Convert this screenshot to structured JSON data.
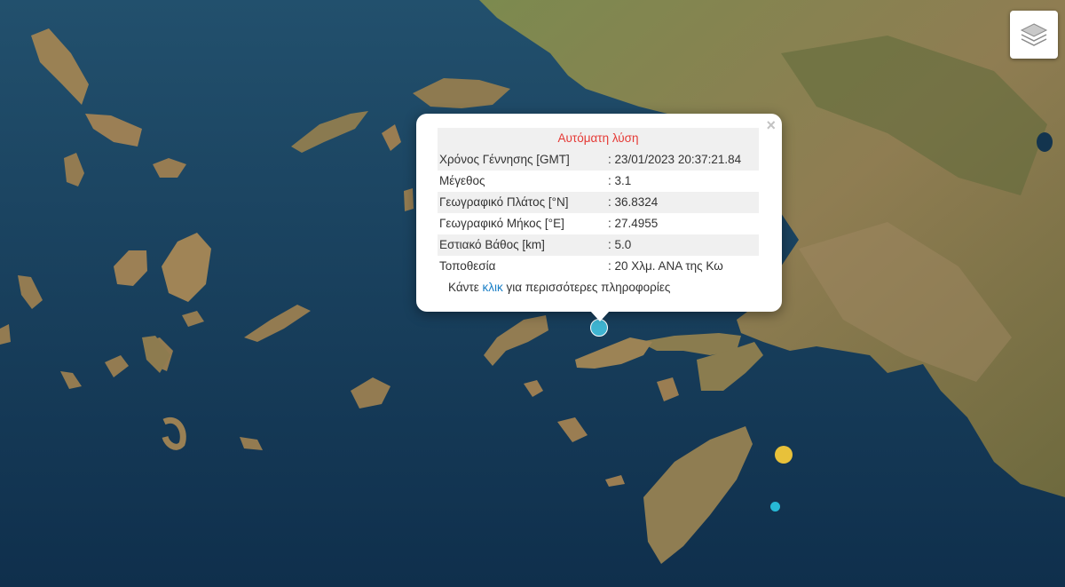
{
  "map": {
    "layers_icon": "layers-icon"
  },
  "popup": {
    "title": "Αυτόματη λύση",
    "title_color": "#e53935",
    "close_symbol": "×",
    "rows": [
      {
        "label": "Χρόνος Γέννησης [GMT]",
        "value": ": 23/01/2023 20:37:21.84"
      },
      {
        "label": "Μέγεθος",
        "value": ": 3.1"
      },
      {
        "label": "Γεωγραφικό Πλάτος [°N]",
        "value": ": 36.8324"
      },
      {
        "label": "Γεωγραφικό Μήκος [°E]",
        "value": ": 27.4955"
      },
      {
        "label": "Εστιακό Βάθος [km]",
        "value": ": 5.0"
      },
      {
        "label": "Τοποθεσία",
        "value": ": 20 Χλμ. ΑΝΑ της Κω"
      }
    ],
    "more_prefix": "Κάντε",
    "more_link": "κλικ",
    "more_suffix": "για περισσότερες πληροφορίες"
  },
  "markers": [
    {
      "name": "selected-quake",
      "color": "#3fb4d1"
    },
    {
      "name": "quake-yellow",
      "color": "#e8c13a"
    },
    {
      "name": "quake-small-cyan",
      "color": "#27b9d6"
    }
  ]
}
